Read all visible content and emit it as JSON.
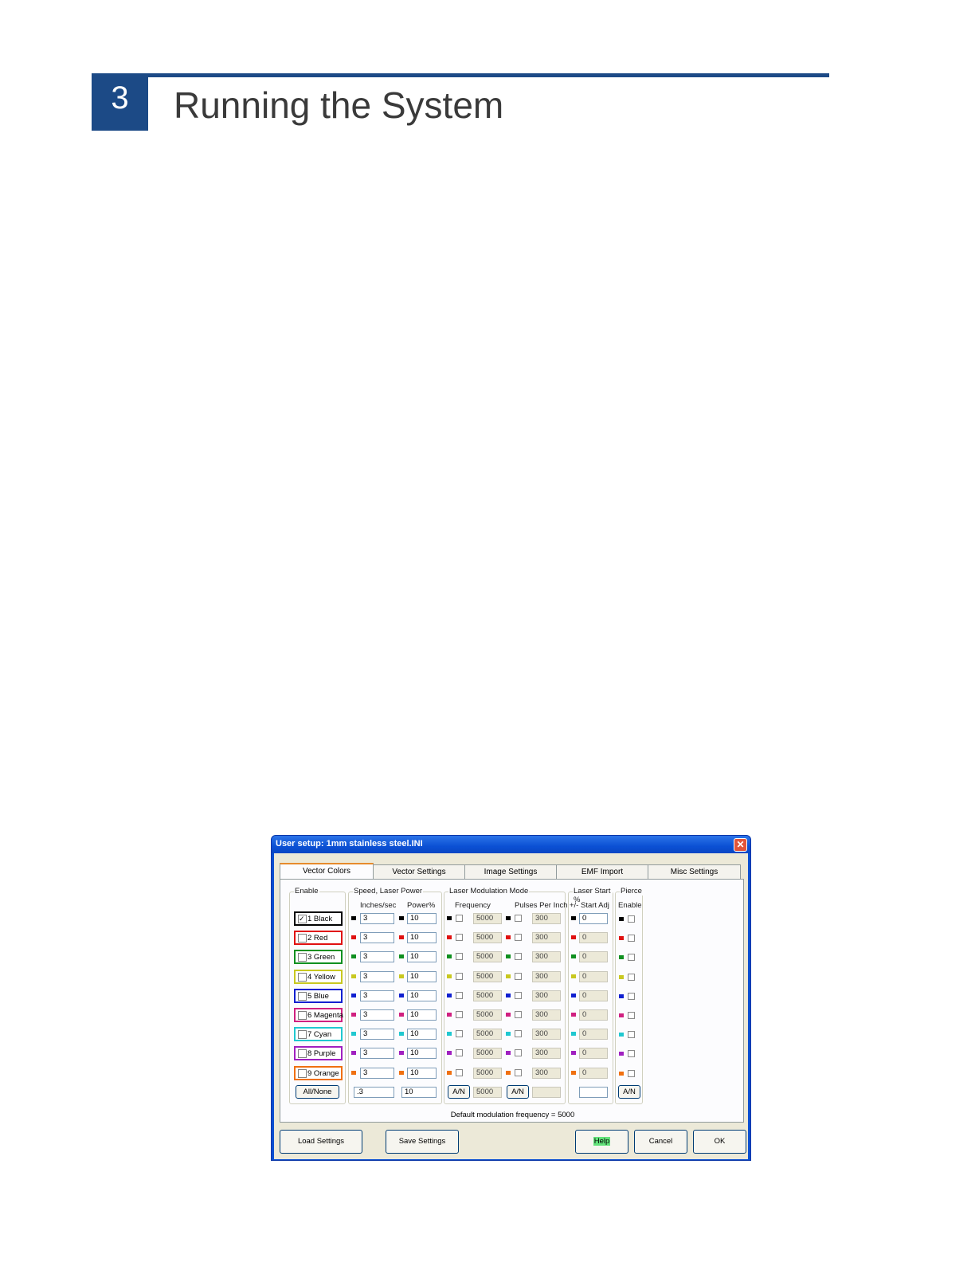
{
  "chapter": {
    "number": "3",
    "title": "Running the System"
  },
  "dialog": {
    "title": "User setup: 1mm stainless steel.INI",
    "close_icon": "close-icon",
    "tabs": [
      "Vector Colors",
      "Vector Settings",
      "Image Settings",
      "EMF Import",
      "Misc Settings"
    ],
    "active_tab": "Vector Colors",
    "groups": {
      "enable": "Enable",
      "speed_power": "Speed, Laser Power",
      "inches_sec": "Inches/sec",
      "power_pct": "Power%",
      "modulation": "Laser Modulation Mode",
      "frequency": "Frequency",
      "ppi": "Pulses Per Inch",
      "laser_start": "Laser Start %",
      "start_adj": "+/- Start Adj",
      "pierce": "Pierce",
      "pierce_enable": "Enable"
    },
    "rows": [
      {
        "label": "1 Black",
        "color": "#000000",
        "checked": true,
        "speed": "3",
        "power": "10",
        "freq": "5000",
        "ppi": "300",
        "start": "0"
      },
      {
        "label": "2 Red",
        "color": "#e01010",
        "checked": false,
        "speed": "3",
        "power": "10",
        "freq": "5000",
        "ppi": "300",
        "start": "0"
      },
      {
        "label": "3 Green",
        "color": "#109020",
        "checked": false,
        "speed": "3",
        "power": "10",
        "freq": "5000",
        "ppi": "300",
        "start": "0"
      },
      {
        "label": "4 Yellow",
        "color": "#c8c820",
        "checked": false,
        "speed": "3",
        "power": "10",
        "freq": "5000",
        "ppi": "300",
        "start": "0"
      },
      {
        "label": "5 Blue",
        "color": "#1020d0",
        "checked": false,
        "speed": "3",
        "power": "10",
        "freq": "5000",
        "ppi": "300",
        "start": "0"
      },
      {
        "label": "6 Magenta",
        "color": "#d02080",
        "checked": false,
        "speed": "3",
        "power": "10",
        "freq": "5000",
        "ppi": "300",
        "start": "0"
      },
      {
        "label": "7 Cyan",
        "color": "#20c8d0",
        "checked": false,
        "speed": "3",
        "power": "10",
        "freq": "5000",
        "ppi": "300",
        "start": "0"
      },
      {
        "label": "8 Purple",
        "color": "#a020c0",
        "checked": false,
        "speed": "3",
        "power": "10",
        "freq": "5000",
        "ppi": "300",
        "start": "0"
      },
      {
        "label": "9 Orange",
        "color": "#f07010",
        "checked": false,
        "speed": "3",
        "power": "10",
        "freq": "5000",
        "ppi": "300",
        "start": "0"
      }
    ],
    "bottom_row": {
      "all_none": "All/None",
      "speed": ".3",
      "power": "10",
      "an_freq": "A/N",
      "freq": "5000",
      "an_ppi": "A/N",
      "ppi": "",
      "start": "",
      "an_pierce": "A/N"
    },
    "default_note": "Default modulation frequency =  5000",
    "buttons": {
      "load": "Load Settings",
      "save": "Save Settings",
      "help": "Help",
      "cancel": "Cancel",
      "ok": "OK"
    }
  }
}
